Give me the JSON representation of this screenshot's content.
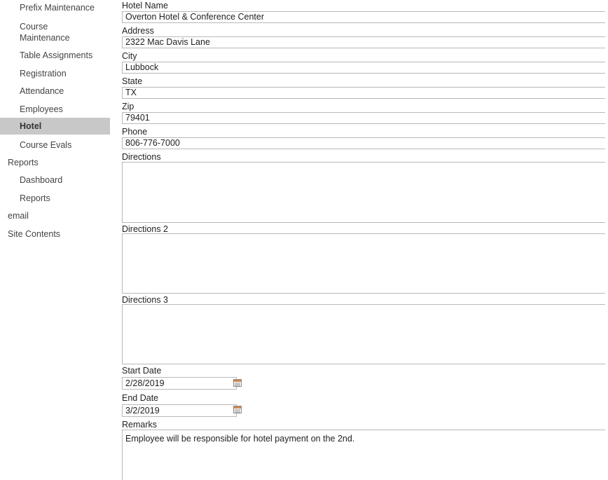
{
  "nav": {
    "items": [
      {
        "label": "Prefix Maintenance"
      },
      {
        "label": "Course Maintenance"
      },
      {
        "label": "Table Assignments"
      },
      {
        "label": "Registration"
      },
      {
        "label": "Attendance"
      },
      {
        "label": "Employees"
      },
      {
        "label": "Hotel",
        "selected": true
      },
      {
        "label": "Course Evals"
      },
      {
        "label": "Reports"
      },
      {
        "label": "Dashboard"
      },
      {
        "label": "Reports"
      },
      {
        "label": "email"
      },
      {
        "label": "Site Contents"
      }
    ]
  },
  "form": {
    "hotel_name": {
      "label": "Hotel Name",
      "value": "Overton Hotel & Conference Center"
    },
    "address": {
      "label": "Address",
      "value": "2322 Mac Davis Lane"
    },
    "city": {
      "label": "City",
      "value": "Lubbock"
    },
    "state": {
      "label": "State",
      "value": "TX"
    },
    "zip": {
      "label": "Zip",
      "value": "79401"
    },
    "phone": {
      "label": "Phone",
      "value": "806-776-7000"
    },
    "directions": {
      "label": "Directions",
      "value": ""
    },
    "directions2": {
      "label": "Directions 2",
      "value": ""
    },
    "directions3": {
      "label": "Directions 3",
      "value": ""
    },
    "start_date": {
      "label": "Start Date",
      "value": "2/28/2019"
    },
    "end_date": {
      "label": "End Date",
      "value": "3/2/2019"
    },
    "remarks": {
      "label": "Remarks",
      "value": "Employee will be responsible for hotel payment on the 2nd."
    }
  },
  "icons": {
    "date_picker": "calendar-icon"
  },
  "colors": {
    "selected_nav_bg": "#c8c8c8",
    "input_border": "#b9b9b9"
  }
}
